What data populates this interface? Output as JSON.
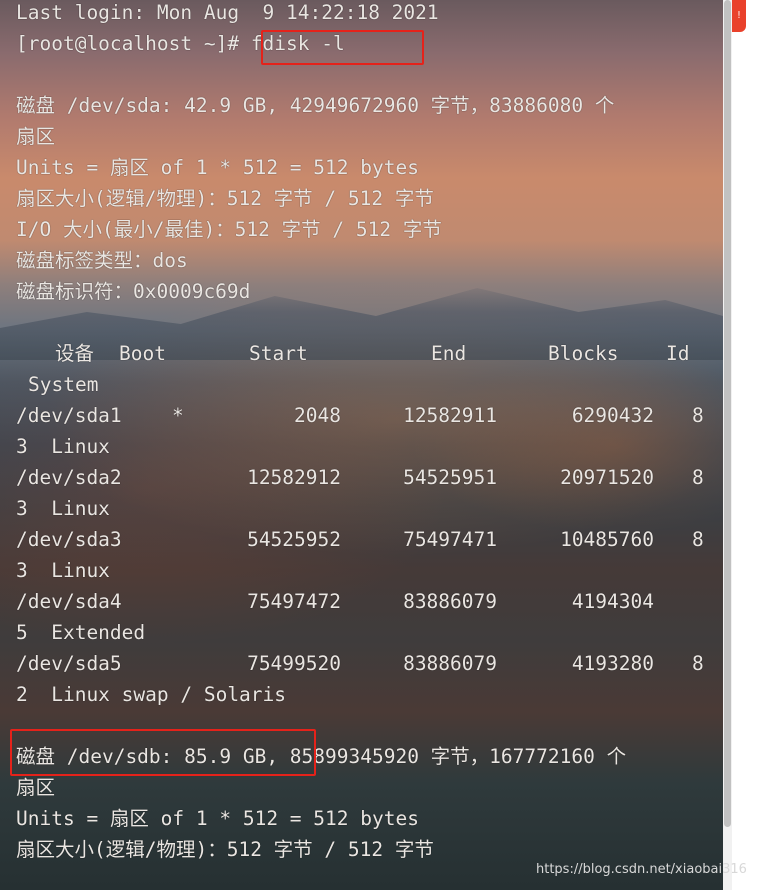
{
  "terminal": {
    "last_login": "Last login: Mon Aug  9 14:22:18 2021",
    "prompt": "[root@localhost ~]# ",
    "command": "fdisk -l",
    "sda": {
      "disk_line": "磁盘 /dev/sda: 42.9 GB, 42949672960 字节，83886080 个",
      "disk_line_cont": "扇区",
      "units": "Units = 扇区 of 1 * 512 = 512 bytes",
      "sector_size": "扇区大小(逻辑/物理)：512 字节 / 512 字节",
      "io_size": "I/O 大小(最小/最佳)：512 字节 / 512 字节",
      "label_type": "磁盘标签类型：dos",
      "identifier": "磁盘标识符：0x0009c69d"
    },
    "partition_table": {
      "headers": {
        "device": "设备",
        "boot": "Boot",
        "start": "Start",
        "end": "End",
        "blocks": "Blocks",
        "id": "Id",
        "system": "System"
      },
      "rows": [
        {
          "device": "/dev/sda1",
          "boot": "*",
          "start": "2048",
          "end": "12582911",
          "blocks": "6290432",
          "id_tail": "8",
          "cont": "3  Linux"
        },
        {
          "device": "/dev/sda2",
          "boot": "",
          "start": "12582912",
          "end": "54525951",
          "blocks": "20971520",
          "id_tail": "8",
          "cont": "3  Linux"
        },
        {
          "device": "/dev/sda3",
          "boot": "",
          "start": "54525952",
          "end": "75497471",
          "blocks": "10485760",
          "id_tail": "8",
          "cont": "3  Linux"
        },
        {
          "device": "/dev/sda4",
          "boot": "",
          "start": "75497472",
          "end": "83886079",
          "blocks": "4194304",
          "id_tail": "",
          "cont": "5  Extended"
        },
        {
          "device": "/dev/sda5",
          "boot": "",
          "start": "75499520",
          "end": "83886079",
          "blocks": "4193280",
          "id_tail": "8",
          "cont": "2  Linux swap / Solaris"
        }
      ]
    },
    "sdb": {
      "disk_line_a": "磁盘 /dev/sdb: 85.9 GB,",
      "disk_line_b": " 85899345920 字节，167772160 个",
      "disk_line_cont": "扇区",
      "units": "Units = 扇区 of 1 * 512 = 512 bytes",
      "sector_size": "扇区大小(逻辑/物理)：512 字节 / 512 字节"
    },
    "highlight_color": "#e5221a"
  },
  "watermark": "https://blog.csdn.net/xiaobai316",
  "side_button": "ǃ",
  "colors": {
    "terminal_text": "#eae6e2",
    "side_button": "#e9412b",
    "scrollbar_track": "#f1f1f1",
    "scrollbar_thumb": "#c1c1c1"
  }
}
